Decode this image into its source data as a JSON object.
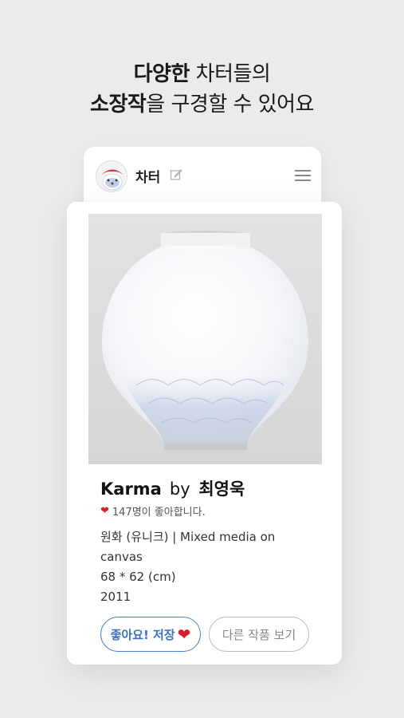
{
  "headline": {
    "line1_bold": "다양한",
    "line1_rest": " 차터들의",
    "line2_bold": "소장작",
    "line2_rest": "을 구경할 수 있어요"
  },
  "profile": {
    "name": "차터",
    "edit_icon": "edit-icon",
    "menu_icon": "hamburger-menu-icon"
  },
  "artwork": {
    "title": "Karma",
    "by": "by",
    "artist": "최영욱",
    "likes_text": "147명이 좋아합니다.",
    "medium": "원화 (유니크) | Mixed media on canvas",
    "size": "68 * 62 (cm)",
    "year": "2011",
    "image_subject": "moon-jar-painting"
  },
  "buttons": {
    "like_save": "좋아요! 저장",
    "like_heart": "❤",
    "more_works": "다른 작품 보기"
  },
  "colors": {
    "background": "#ebebeb",
    "accent_blue": "#3d74c4",
    "heart_red": "#d41f2b"
  }
}
